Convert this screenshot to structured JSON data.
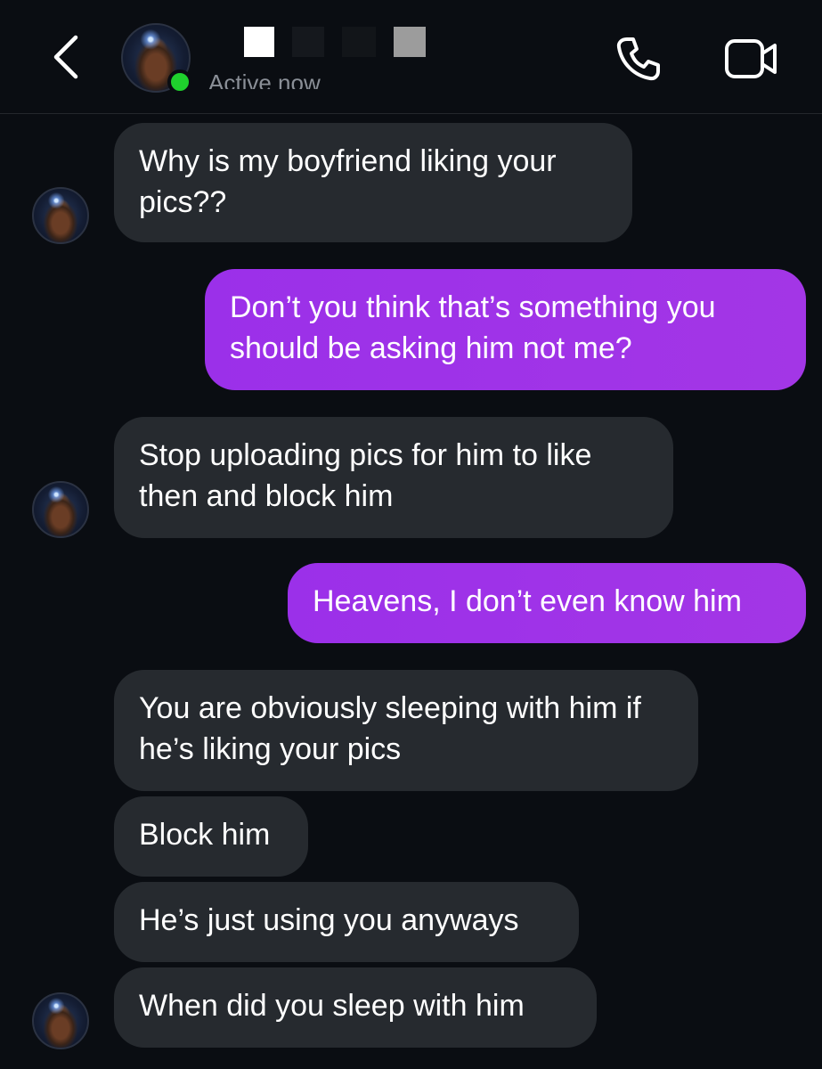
{
  "header": {
    "status": "Active now",
    "icons": {
      "back": "chevron-left-icon",
      "call": "phone-icon",
      "video": "video-camera-icon"
    }
  },
  "colors": {
    "background": "#0a0d12",
    "incoming_bubble": "#262a2f",
    "outgoing_bubble": "#a336e6",
    "active_dot": "#1fd12d"
  },
  "messages": [
    {
      "from": "them",
      "text": "Why is my boyfriend liking your pics??"
    },
    {
      "from": "me",
      "text": "Don’t you think that’s something you should be asking him not me?"
    },
    {
      "from": "them",
      "text": "Stop uploading pics for him to like then and block him"
    },
    {
      "from": "me",
      "text": "Heavens, I don’t even know him"
    },
    {
      "from": "them",
      "text": "You are obviously sleeping with him if he’s liking your pics"
    },
    {
      "from": "them",
      "text": "Block him"
    },
    {
      "from": "them",
      "text": "He’s just using you anyways"
    },
    {
      "from": "them",
      "text": "When did you sleep with  him"
    }
  ]
}
